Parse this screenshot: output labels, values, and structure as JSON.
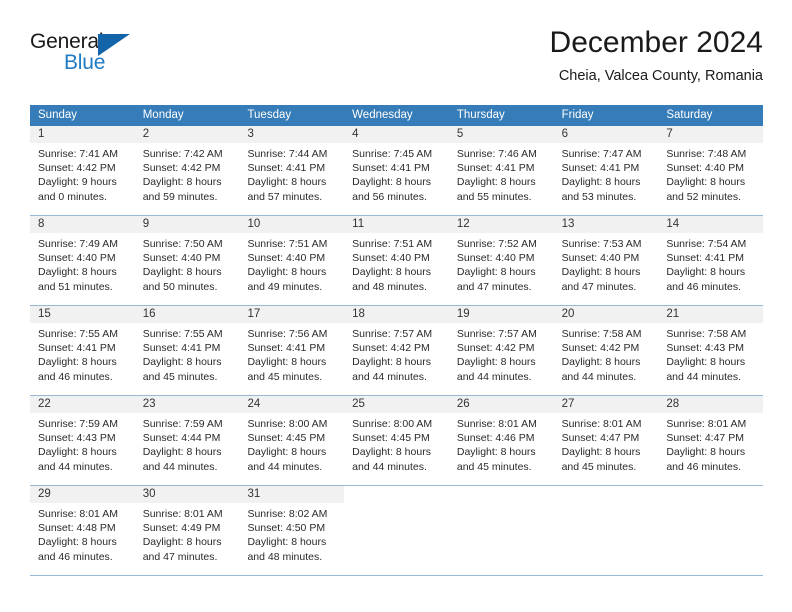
{
  "logo": {
    "word_top": "General",
    "word_bottom": "Blue",
    "triangle_color": "#1464aa",
    "blue_text_color": "#1f7bc4"
  },
  "header": {
    "title": "December 2024",
    "subtitle": "Cheia, Valcea County, Romania"
  },
  "theme": {
    "header_row_bg": "#357cb8",
    "daynum_band_bg": "#f1f1f1",
    "week_divider": "#9ab8d4"
  },
  "weekdays": [
    "Sunday",
    "Monday",
    "Tuesday",
    "Wednesday",
    "Thursday",
    "Friday",
    "Saturday"
  ],
  "weeks": [
    [
      {
        "day": "1",
        "sunrise": "Sunrise: 7:41 AM",
        "sunset": "Sunset: 4:42 PM",
        "daylight1": "Daylight: 9 hours",
        "daylight2": "and 0 minutes."
      },
      {
        "day": "2",
        "sunrise": "Sunrise: 7:42 AM",
        "sunset": "Sunset: 4:42 PM",
        "daylight1": "Daylight: 8 hours",
        "daylight2": "and 59 minutes."
      },
      {
        "day": "3",
        "sunrise": "Sunrise: 7:44 AM",
        "sunset": "Sunset: 4:41 PM",
        "daylight1": "Daylight: 8 hours",
        "daylight2": "and 57 minutes."
      },
      {
        "day": "4",
        "sunrise": "Sunrise: 7:45 AM",
        "sunset": "Sunset: 4:41 PM",
        "daylight1": "Daylight: 8 hours",
        "daylight2": "and 56 minutes."
      },
      {
        "day": "5",
        "sunrise": "Sunrise: 7:46 AM",
        "sunset": "Sunset: 4:41 PM",
        "daylight1": "Daylight: 8 hours",
        "daylight2": "and 55 minutes."
      },
      {
        "day": "6",
        "sunrise": "Sunrise: 7:47 AM",
        "sunset": "Sunset: 4:41 PM",
        "daylight1": "Daylight: 8 hours",
        "daylight2": "and 53 minutes."
      },
      {
        "day": "7",
        "sunrise": "Sunrise: 7:48 AM",
        "sunset": "Sunset: 4:40 PM",
        "daylight1": "Daylight: 8 hours",
        "daylight2": "and 52 minutes."
      }
    ],
    [
      {
        "day": "8",
        "sunrise": "Sunrise: 7:49 AM",
        "sunset": "Sunset: 4:40 PM",
        "daylight1": "Daylight: 8 hours",
        "daylight2": "and 51 minutes."
      },
      {
        "day": "9",
        "sunrise": "Sunrise: 7:50 AM",
        "sunset": "Sunset: 4:40 PM",
        "daylight1": "Daylight: 8 hours",
        "daylight2": "and 50 minutes."
      },
      {
        "day": "10",
        "sunrise": "Sunrise: 7:51 AM",
        "sunset": "Sunset: 4:40 PM",
        "daylight1": "Daylight: 8 hours",
        "daylight2": "and 49 minutes."
      },
      {
        "day": "11",
        "sunrise": "Sunrise: 7:51 AM",
        "sunset": "Sunset: 4:40 PM",
        "daylight1": "Daylight: 8 hours",
        "daylight2": "and 48 minutes."
      },
      {
        "day": "12",
        "sunrise": "Sunrise: 7:52 AM",
        "sunset": "Sunset: 4:40 PM",
        "daylight1": "Daylight: 8 hours",
        "daylight2": "and 47 minutes."
      },
      {
        "day": "13",
        "sunrise": "Sunrise: 7:53 AM",
        "sunset": "Sunset: 4:40 PM",
        "daylight1": "Daylight: 8 hours",
        "daylight2": "and 47 minutes."
      },
      {
        "day": "14",
        "sunrise": "Sunrise: 7:54 AM",
        "sunset": "Sunset: 4:41 PM",
        "daylight1": "Daylight: 8 hours",
        "daylight2": "and 46 minutes."
      }
    ],
    [
      {
        "day": "15",
        "sunrise": "Sunrise: 7:55 AM",
        "sunset": "Sunset: 4:41 PM",
        "daylight1": "Daylight: 8 hours",
        "daylight2": "and 46 minutes."
      },
      {
        "day": "16",
        "sunrise": "Sunrise: 7:55 AM",
        "sunset": "Sunset: 4:41 PM",
        "daylight1": "Daylight: 8 hours",
        "daylight2": "and 45 minutes."
      },
      {
        "day": "17",
        "sunrise": "Sunrise: 7:56 AM",
        "sunset": "Sunset: 4:41 PM",
        "daylight1": "Daylight: 8 hours",
        "daylight2": "and 45 minutes."
      },
      {
        "day": "18",
        "sunrise": "Sunrise: 7:57 AM",
        "sunset": "Sunset: 4:42 PM",
        "daylight1": "Daylight: 8 hours",
        "daylight2": "and 44 minutes."
      },
      {
        "day": "19",
        "sunrise": "Sunrise: 7:57 AM",
        "sunset": "Sunset: 4:42 PM",
        "daylight1": "Daylight: 8 hours",
        "daylight2": "and 44 minutes."
      },
      {
        "day": "20",
        "sunrise": "Sunrise: 7:58 AM",
        "sunset": "Sunset: 4:42 PM",
        "daylight1": "Daylight: 8 hours",
        "daylight2": "and 44 minutes."
      },
      {
        "day": "21",
        "sunrise": "Sunrise: 7:58 AM",
        "sunset": "Sunset: 4:43 PM",
        "daylight1": "Daylight: 8 hours",
        "daylight2": "and 44 minutes."
      }
    ],
    [
      {
        "day": "22",
        "sunrise": "Sunrise: 7:59 AM",
        "sunset": "Sunset: 4:43 PM",
        "daylight1": "Daylight: 8 hours",
        "daylight2": "and 44 minutes."
      },
      {
        "day": "23",
        "sunrise": "Sunrise: 7:59 AM",
        "sunset": "Sunset: 4:44 PM",
        "daylight1": "Daylight: 8 hours",
        "daylight2": "and 44 minutes."
      },
      {
        "day": "24",
        "sunrise": "Sunrise: 8:00 AM",
        "sunset": "Sunset: 4:45 PM",
        "daylight1": "Daylight: 8 hours",
        "daylight2": "and 44 minutes."
      },
      {
        "day": "25",
        "sunrise": "Sunrise: 8:00 AM",
        "sunset": "Sunset: 4:45 PM",
        "daylight1": "Daylight: 8 hours",
        "daylight2": "and 44 minutes."
      },
      {
        "day": "26",
        "sunrise": "Sunrise: 8:01 AM",
        "sunset": "Sunset: 4:46 PM",
        "daylight1": "Daylight: 8 hours",
        "daylight2": "and 45 minutes."
      },
      {
        "day": "27",
        "sunrise": "Sunrise: 8:01 AM",
        "sunset": "Sunset: 4:47 PM",
        "daylight1": "Daylight: 8 hours",
        "daylight2": "and 45 minutes."
      },
      {
        "day": "28",
        "sunrise": "Sunrise: 8:01 AM",
        "sunset": "Sunset: 4:47 PM",
        "daylight1": "Daylight: 8 hours",
        "daylight2": "and 46 minutes."
      }
    ],
    [
      {
        "day": "29",
        "sunrise": "Sunrise: 8:01 AM",
        "sunset": "Sunset: 4:48 PM",
        "daylight1": "Daylight: 8 hours",
        "daylight2": "and 46 minutes."
      },
      {
        "day": "30",
        "sunrise": "Sunrise: 8:01 AM",
        "sunset": "Sunset: 4:49 PM",
        "daylight1": "Daylight: 8 hours",
        "daylight2": "and 47 minutes."
      },
      {
        "day": "31",
        "sunrise": "Sunrise: 8:02 AM",
        "sunset": "Sunset: 4:50 PM",
        "daylight1": "Daylight: 8 hours",
        "daylight2": "and 48 minutes."
      },
      {
        "day": "",
        "sunrise": "",
        "sunset": "",
        "daylight1": "",
        "daylight2": ""
      },
      {
        "day": "",
        "sunrise": "",
        "sunset": "",
        "daylight1": "",
        "daylight2": ""
      },
      {
        "day": "",
        "sunrise": "",
        "sunset": "",
        "daylight1": "",
        "daylight2": ""
      },
      {
        "day": "",
        "sunrise": "",
        "sunset": "",
        "daylight1": "",
        "daylight2": ""
      }
    ]
  ]
}
